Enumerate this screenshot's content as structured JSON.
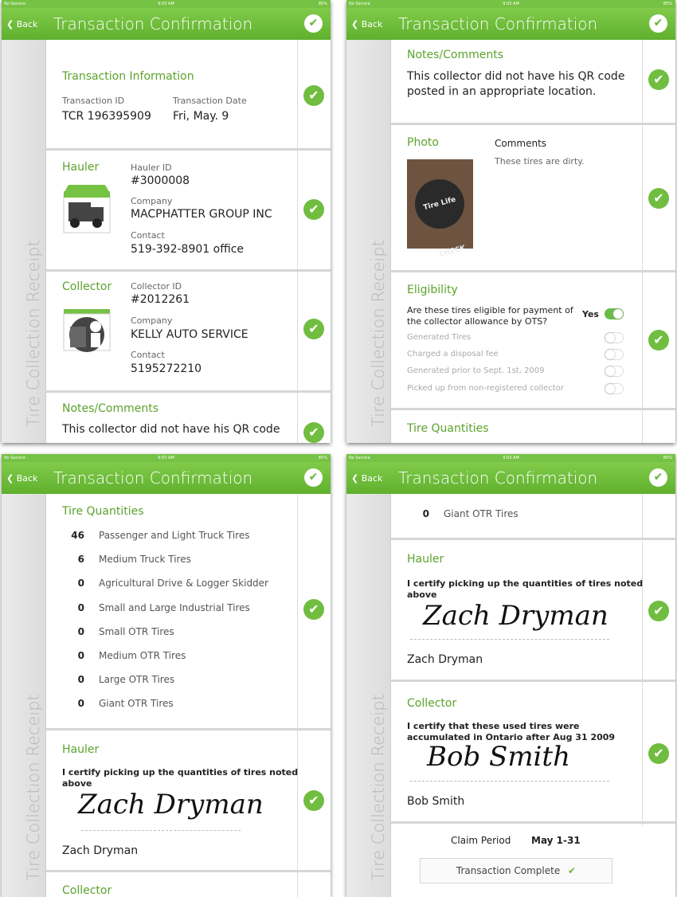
{
  "status": {
    "carrier": "No Service",
    "time": "9:03 AM",
    "battery": "85%"
  },
  "nav": {
    "back": "Back",
    "title": "Transaction Confirmation",
    "check": "✔"
  },
  "side": "Tire Collection Receipt",
  "ti": {
    "heading": "Transaction Information",
    "id_label": "Transaction ID",
    "id": "TCR  196395909",
    "date_label": "Transaction Date",
    "date": "Fri, May. 9"
  },
  "hauler": {
    "heading": "Hauler",
    "id_label": "Hauler ID",
    "id": "#3000008",
    "company_label": "Company",
    "company": "MACPHATTER  GROUP INC",
    "contact_label": "Contact",
    "contact": "519-392-8901 office"
  },
  "collector": {
    "heading": "Collector",
    "id_label": "Collector ID",
    "id": "#2012261",
    "company_label": "Company",
    "company": "KELLY AUTO SERVICE",
    "contact_label": "Contact",
    "contact": "5195272210"
  },
  "notes": {
    "heading": "Notes/Comments",
    "text1": "This collector did not have his QR code",
    "text2": "posted in an appropriate location."
  },
  "photo": {
    "heading": "Photo",
    "comments_label": "Comments",
    "comments": "These tires are dirty.",
    "photo_text": "Tire Life CHECK"
  },
  "eligibility": {
    "heading": "Eligibility",
    "question1": "Are these tires eligible for payment of",
    "question2": "the collector allowance by OTS?",
    "answer": "Yes",
    "options": [
      "Generated Tires",
      "Charged a disposal fee",
      "Generated prior to Sept. 1st, 2009",
      "Picked up from non-registered collector"
    ]
  },
  "quantities": {
    "heading": "Tire Quantities",
    "items": [
      {
        "qty": "46",
        "name": "Passenger and Light Truck Tires"
      },
      {
        "qty": "6",
        "name": "Medium Truck Tires"
      },
      {
        "qty": "0",
        "name": "Agricultural Drive & Logger Skidder"
      },
      {
        "qty": "0",
        "name": "Small and Large Industrial Tires"
      },
      {
        "qty": "0",
        "name": "Small OTR Tires"
      },
      {
        "qty": "0",
        "name": "Medium OTR Tires"
      },
      {
        "qty": "0",
        "name": "Large OTR Tires"
      },
      {
        "qty": "0",
        "name": "Giant OTR Tires"
      }
    ]
  },
  "hauler_cert": {
    "heading": "Hauler",
    "line1": "I certify picking up the quantities of tires noted",
    "line2": "above",
    "signature": "Zach Dryman",
    "name": "Zach Dryman"
  },
  "collector_cert": {
    "heading": "Collector",
    "line1": "I certify that these used tires were",
    "line2": "accumulated in Ontario after Aug 31 2009",
    "signature": "Bob Smith",
    "name": "Bob Smith"
  },
  "claim": {
    "label": "Claim Period",
    "value": "May 1-31"
  },
  "complete": {
    "label": "Transaction Complete",
    "check": "✔"
  }
}
